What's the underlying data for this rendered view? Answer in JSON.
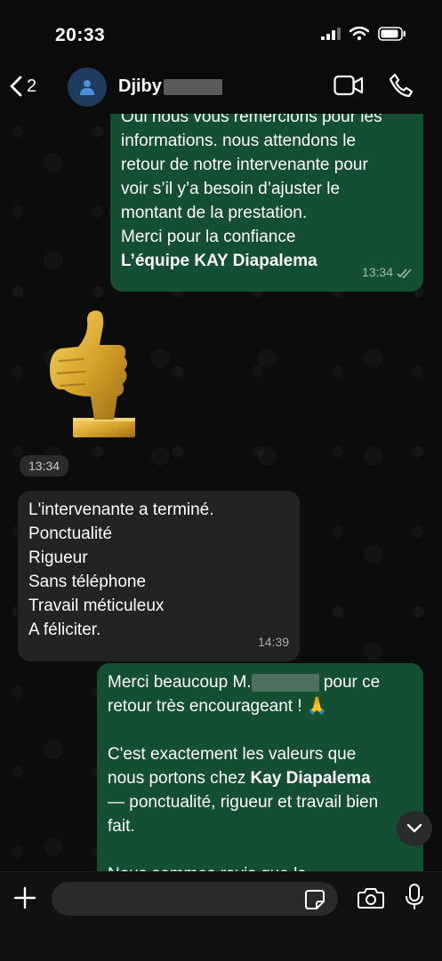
{
  "status_bar": {
    "time": "20:33"
  },
  "header": {
    "back_count": "2",
    "contact_name": "Djiby"
  },
  "messages": [
    {
      "lines": [
        "Oui nous vous remercions pour les",
        "informations. nous attendons le",
        "retour de notre intervenante pour",
        "voir s’il y’a besoin d’ajuster le",
        "montant de la prestation.",
        "Merci pour la confiance"
      ],
      "signature": "L’équipe KAY Diapalema",
      "time": "13:34"
    },
    {
      "sticker_time": "13:34"
    },
    {
      "lines": [
        "L'intervenante a terminé.",
        "Ponctualité",
        "Rigueur",
        "Sans téléphone",
        "Travail méticuleux",
        "A féliciter."
      ],
      "time": "14:39"
    },
    {
      "p1_start": "Merci beaucoup M.",
      "p1_end": " pour ce",
      "p1_line2": "retour très encourageant ! 🙏",
      "p2_line1": "C'est exactement les valeurs que",
      "p2_line2_start": "nous portons chez ",
      "p2_bold": "Kay Diapalema",
      "p2_line3": "— ponctualité, rigueur et travail bien",
      "p2_line4": "fait.",
      "p3_partial": "Nous sommes ravis que la"
    }
  ],
  "input": {
    "placeholder": ""
  },
  "colors": {
    "outgoing": "#154f31",
    "incoming": "#222325",
    "background": "#0c0c0c"
  },
  "icons": [
    "signal-icon",
    "wifi-icon",
    "battery-icon",
    "back-chevron-icon",
    "person-icon",
    "video-call-icon",
    "phone-icon",
    "double-check-icon",
    "chevron-down-icon",
    "plus-icon",
    "sticker-icon",
    "camera-icon",
    "mic-icon"
  ]
}
